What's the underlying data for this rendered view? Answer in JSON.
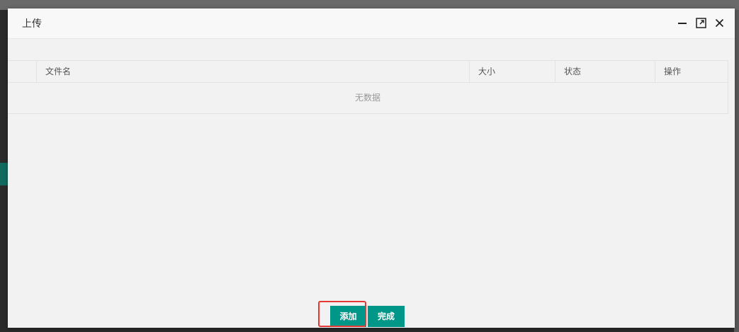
{
  "modal": {
    "title": "上传",
    "controls": {
      "minimize_icon": "minimize-icon",
      "maximize_icon": "maximize-icon",
      "close_icon": "close-icon"
    }
  },
  "table": {
    "columns": [
      "文件名",
      "大小",
      "状态",
      "操作"
    ],
    "empty_text": "无数据"
  },
  "footer": {
    "add_label": "添加",
    "done_label": "完成"
  },
  "colors": {
    "accent": "#009688",
    "highlight": "#e53935"
  }
}
